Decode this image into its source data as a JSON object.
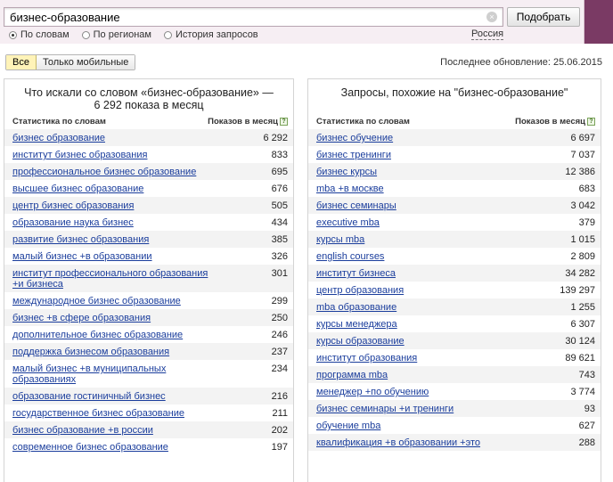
{
  "search": {
    "query": "бизнес-образование",
    "button_label": "Подобрать",
    "clear_glyph": "×",
    "modes": [
      {
        "label": "По словам",
        "selected": true
      },
      {
        "label": "По регионам",
        "selected": false
      },
      {
        "label": "История запросов",
        "selected": false
      }
    ],
    "region": "Россия"
  },
  "toolbar": {
    "filter_all": "Все",
    "filter_mobile": "Только мобильные",
    "last_update": "Последнее обновление: 25.06.2015"
  },
  "left_panel": {
    "title": "Что искали со словом «бизнес-образование» — 6 292 показа в месяц",
    "col_phrase": "Статистика по словам",
    "col_count": "Показов в месяц",
    "help_glyph": "?",
    "rows": [
      {
        "q": "бизнес образование",
        "n": "6 292"
      },
      {
        "q": "институт бизнес образования",
        "n": "833"
      },
      {
        "q": "профессиональное бизнес образование",
        "n": "695"
      },
      {
        "q": "высшее бизнес образование",
        "n": "676"
      },
      {
        "q": "центр бизнес образования",
        "n": "505"
      },
      {
        "q": "образование наука бизнес",
        "n": "434"
      },
      {
        "q": "развитие бизнес образования",
        "n": "385"
      },
      {
        "q": "малый бизнес +в образовании",
        "n": "326"
      },
      {
        "q": "институт профессионального образования +и бизнеса",
        "n": "301"
      },
      {
        "q": "международное бизнес образование",
        "n": "299"
      },
      {
        "q": "бизнес +в сфере образования",
        "n": "250"
      },
      {
        "q": "дополнительное бизнес образование",
        "n": "246"
      },
      {
        "q": "поддержка бизнесом образования",
        "n": "237"
      },
      {
        "q": "малый бизнес +в муниципальных образованиях",
        "n": "234"
      },
      {
        "q": "образование гостиничный бизнес",
        "n": "216"
      },
      {
        "q": "государственное бизнес образование",
        "n": "211"
      },
      {
        "q": "бизнес образование +в россии",
        "n": "202"
      },
      {
        "q": "современное бизнес образование",
        "n": "197"
      }
    ]
  },
  "right_panel": {
    "title": "Запросы, похожие на \"бизнес-образование\"",
    "col_phrase": "Статистика по словам",
    "col_count": "Показов в месяц",
    "help_glyph": "?",
    "rows": [
      {
        "q": "бизнес обучение",
        "n": "6 697"
      },
      {
        "q": "бизнес тренинги",
        "n": "7 037"
      },
      {
        "q": "бизнес курсы",
        "n": "12 386"
      },
      {
        "q": "mba +в москве",
        "n": "683"
      },
      {
        "q": "бизнес семинары",
        "n": "3 042"
      },
      {
        "q": "executive mba",
        "n": "379"
      },
      {
        "q": "курсы mba",
        "n": "1 015"
      },
      {
        "q": "english courses",
        "n": "2 809"
      },
      {
        "q": "институт бизнеса",
        "n": "34 282"
      },
      {
        "q": "центр образования",
        "n": "139 297"
      },
      {
        "q": "mba образование",
        "n": "1 255"
      },
      {
        "q": "курсы менеджера",
        "n": "6 307"
      },
      {
        "q": "курсы образование",
        "n": "30 124"
      },
      {
        "q": "институт образования",
        "n": "89 621"
      },
      {
        "q": "программа mba",
        "n": "743"
      },
      {
        "q": "менеджер +по обучению",
        "n": "3 774"
      },
      {
        "q": "бизнес семинары +и тренинги",
        "n": "93"
      },
      {
        "q": "обучение mba",
        "n": "627"
      },
      {
        "q": "квалификация +в образовании +это",
        "n": "288"
      }
    ]
  }
}
